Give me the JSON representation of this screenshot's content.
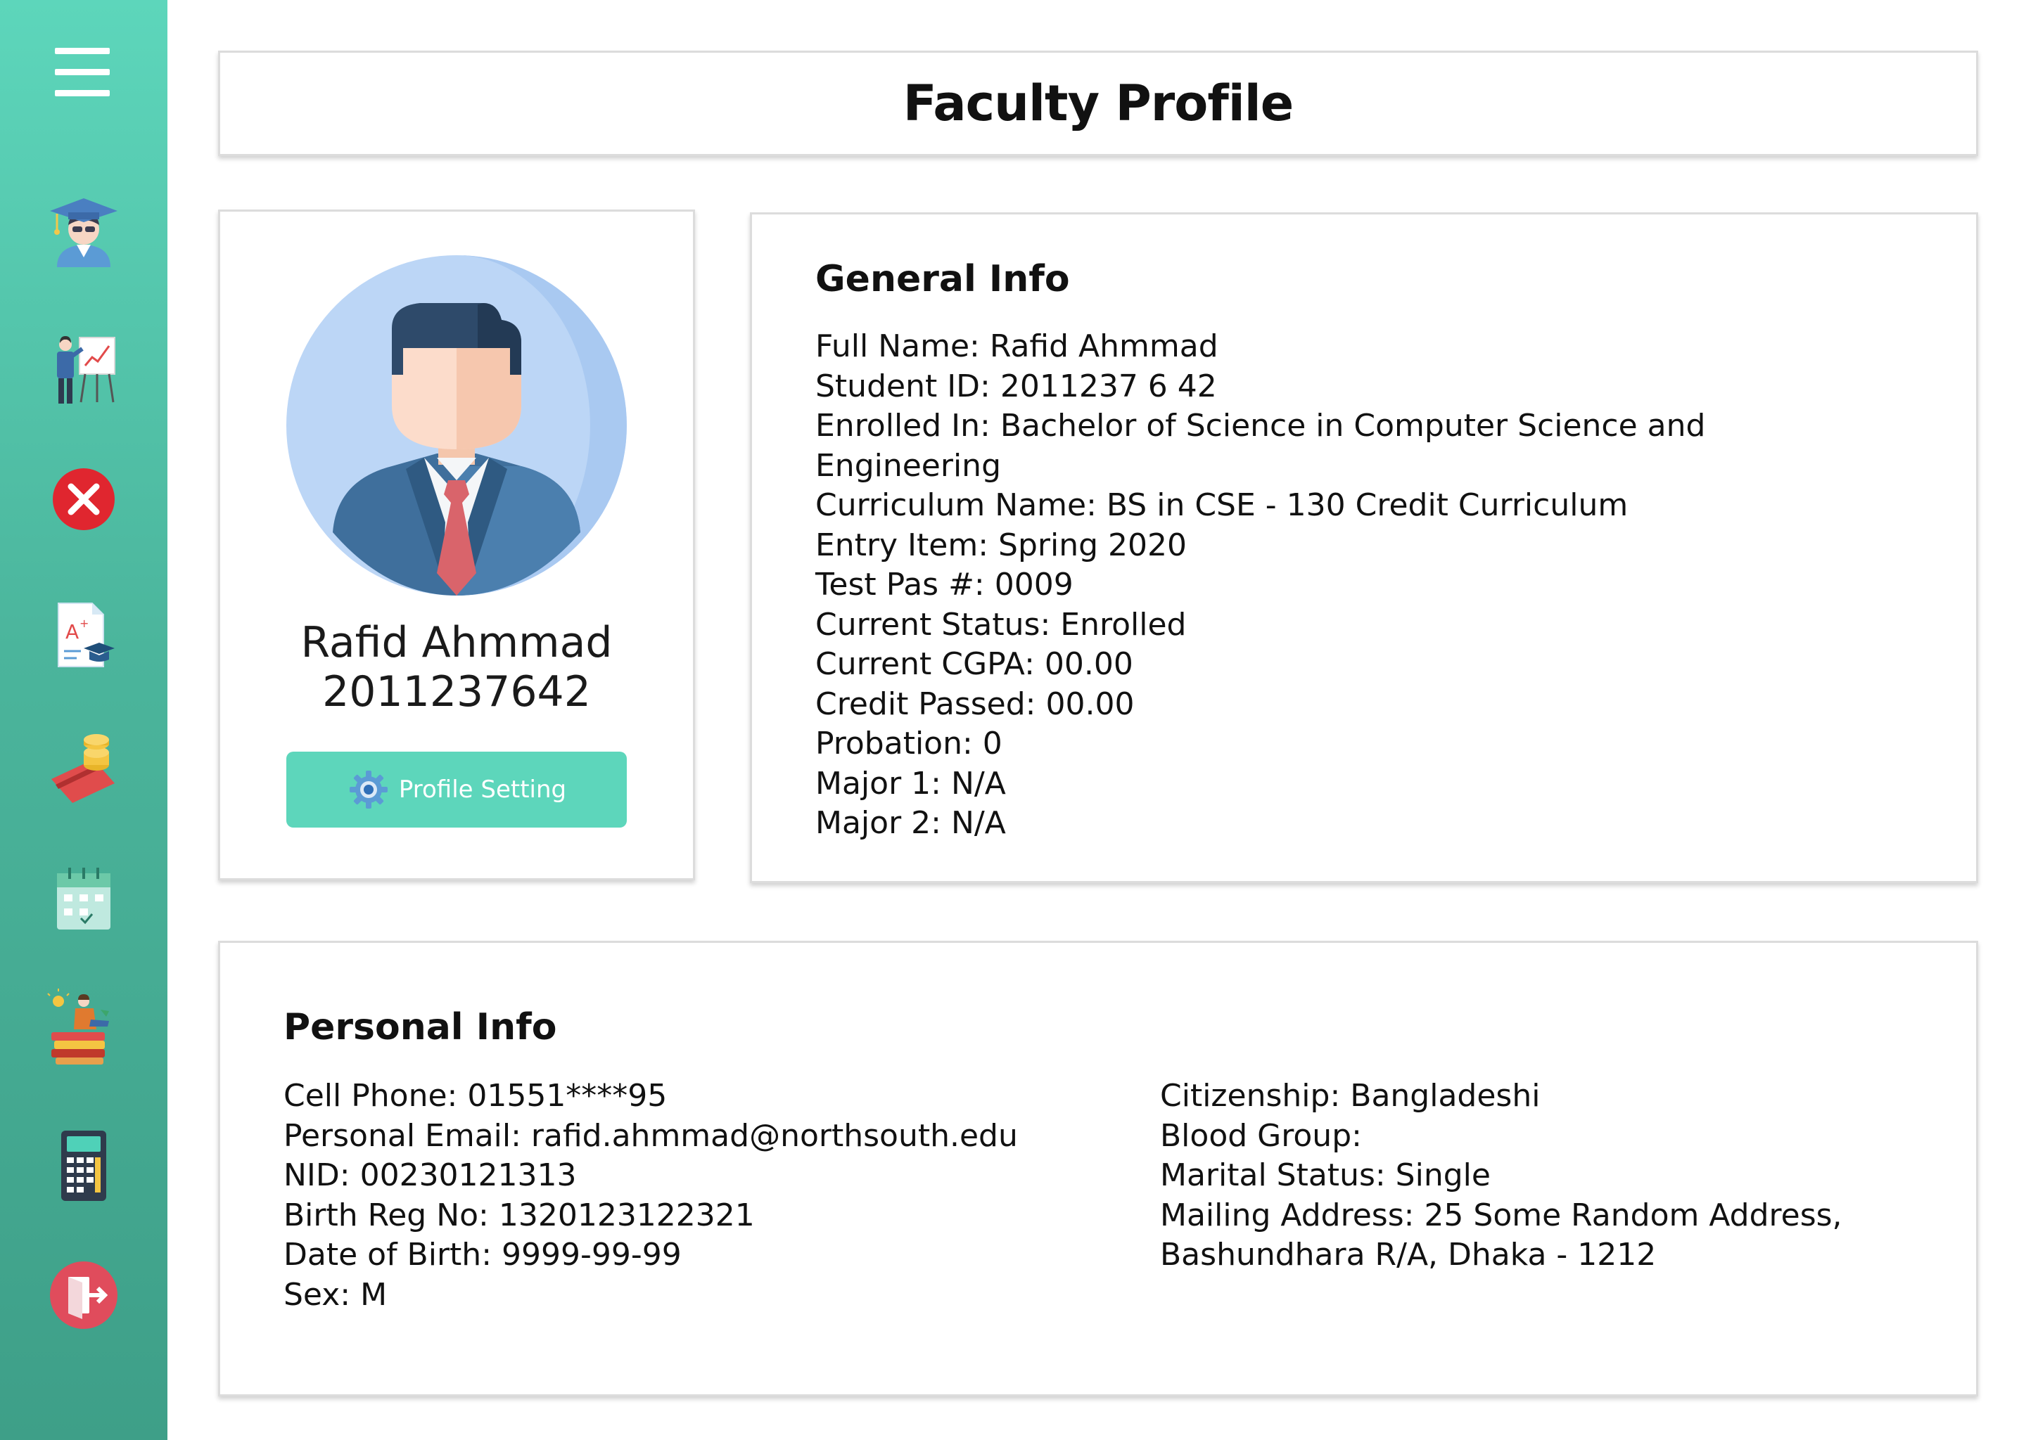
{
  "sidebar": {
    "items": [
      {
        "icon": "graduate-icon"
      },
      {
        "icon": "teacher-presentation-icon"
      },
      {
        "icon": "cancel-icon"
      },
      {
        "icon": "grade-report-icon"
      },
      {
        "icon": "payment-icon"
      },
      {
        "icon": "calendar-icon"
      },
      {
        "icon": "study-activity-icon"
      },
      {
        "icon": "calculator-icon"
      },
      {
        "icon": "logout-icon"
      }
    ],
    "colors": {
      "top": "#5dd6bb",
      "bottom": "#3e9f88"
    }
  },
  "header": {
    "title": "Faculty Profile"
  },
  "profile": {
    "name": "Rafid Ahmmad",
    "id": "2011237642",
    "button_label": "Profile Setting",
    "button_color": "#5dd6bb"
  },
  "general_info": {
    "heading": "General Info",
    "lines": [
      "Full Name:  Rafid Ahmmad",
      "Student ID: 2011237 6 42",
      "Enrolled In: Bachelor of Science in Computer Science and",
      "Engineering",
      "Curriculum Name: BS in CSE - 130 Credit Curriculum",
      "Entry Item: Spring 2020",
      "Test Pas #: 0009",
      "Current Status: Enrolled",
      "Current CGPA: 00.00",
      "Credit Passed: 00.00",
      "Probation: 0",
      "Major 1: N/A",
      "Major 2: N/A"
    ]
  },
  "personal_info": {
    "heading": "Personal Info",
    "left": [
      "Cell Phone: 01551****95",
      "Personal Email: rafid.ahmmad@northsouth.edu",
      "NID: 00230121313",
      "Birth Reg No: 1320123122321",
      "Date of Birth: 9999-99-99",
      "Sex: M"
    ],
    "right": [
      "Citizenship: Bangladeshi",
      "Blood Group:",
      "Marital Status: Single",
      "Mailing Address: 25 Some Random Address,",
      "Bashundhara R/A, Dhaka - 1212"
    ]
  }
}
